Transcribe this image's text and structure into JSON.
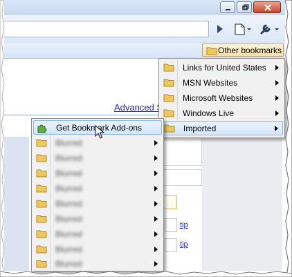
{
  "toolbar": {
    "go_icon": "go-arrow-icon",
    "page_icon": "page-menu-icon",
    "wrench_icon": "wrench-icon"
  },
  "bookmarks_bar": {
    "other_bookmarks_label": "Other bookmarks"
  },
  "content": {
    "advanced_link": "Advanced S",
    "tip_1": "tip",
    "tip_2": "tip"
  },
  "other_bookmarks_menu": {
    "items": [
      {
        "label": "Links for United States",
        "icon": "folder-icon",
        "has_submenu": true
      },
      {
        "label": "MSN Websites",
        "icon": "folder-icon",
        "has_submenu": true
      },
      {
        "label": "Microsoft Websites",
        "icon": "folder-icon",
        "has_submenu": true
      },
      {
        "label": "Windows Live",
        "icon": "folder-icon",
        "has_submenu": true
      },
      {
        "label": "Imported",
        "icon": "folder-icon",
        "has_submenu": true,
        "highlighted": true
      }
    ]
  },
  "imported_menu": {
    "items": [
      {
        "label": "Get Bookmark Add-ons",
        "icon": "puzzle-icon",
        "has_submenu": false,
        "highlighted": true
      },
      {
        "label": "Blurred",
        "icon": "folder-icon",
        "has_submenu": true
      },
      {
        "label": "Blurred",
        "icon": "folder-icon",
        "has_submenu": true
      },
      {
        "label": "Blurred",
        "icon": "folder-icon",
        "has_submenu": true
      },
      {
        "label": "Blurred",
        "icon": "folder-icon",
        "has_submenu": true
      },
      {
        "label": "Blurred",
        "icon": "folder-icon",
        "has_submenu": true
      },
      {
        "label": "Blurred",
        "icon": "folder-icon",
        "has_submenu": true
      },
      {
        "label": "Blurred",
        "icon": "folder-icon",
        "has_submenu": true
      },
      {
        "label": "Blurred",
        "icon": "folder-icon",
        "has_submenu": true
      },
      {
        "label": "Blurred",
        "icon": "folder-icon",
        "has_submenu": true
      }
    ]
  },
  "colors": {
    "folder": "#f1c65a",
    "highlight": "#d3e6fb",
    "link": "#1a28c7"
  }
}
